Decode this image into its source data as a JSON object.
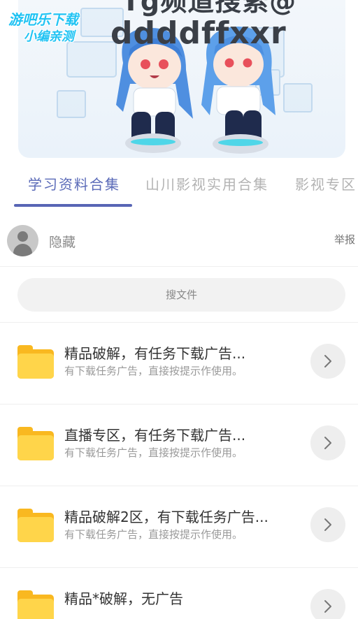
{
  "banner": {
    "line1": "Tg频道搜索@",
    "line2": "ddddffxxr"
  },
  "watermark": {
    "line1": "游吧乐下载",
    "line2": "小编亲测"
  },
  "tabs": [
    {
      "label": "学习资料合集",
      "active": true
    },
    {
      "label": "山川影视实用合集",
      "active": false
    },
    {
      "label": "影视专区",
      "active": false
    }
  ],
  "author": {
    "name": "隐藏",
    "report_label": "举报"
  },
  "search": {
    "placeholder": "搜文件"
  },
  "items": [
    {
      "title": "精品破解，有任务下载广告...",
      "subtitle": "有下载任务广告，直接按提示作使用。"
    },
    {
      "title": "直播专区，有任务下载广告...",
      "subtitle": "有下载任务广告，直接按提示作使用。"
    },
    {
      "title": "精品破解2区，有下载任务广告...",
      "subtitle": "有下载任务广告，直接按提示作使用。"
    },
    {
      "title": "精品*破解，无广告",
      "subtitle": ""
    }
  ],
  "colors": {
    "accent": "#5865b5",
    "folder": "#ffd54a",
    "watermark": "#21c3f3"
  }
}
